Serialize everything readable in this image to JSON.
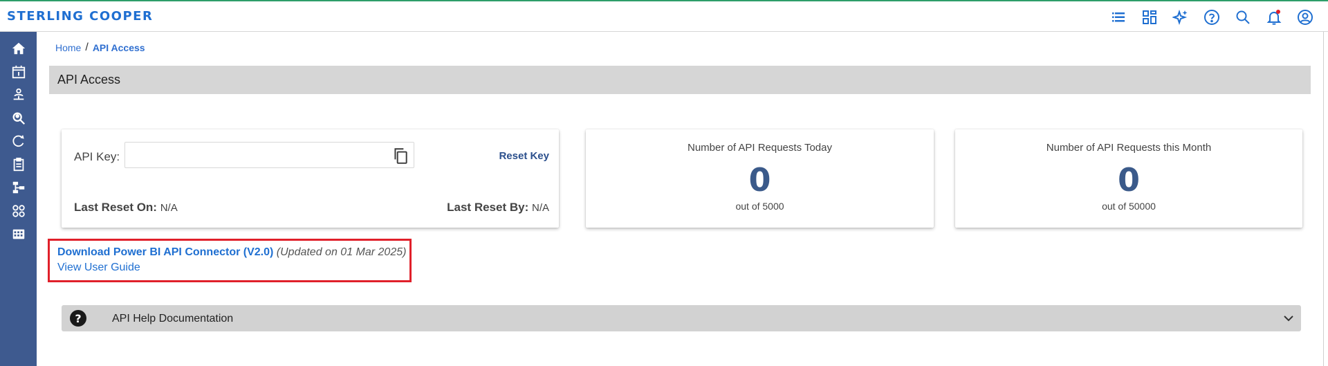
{
  "app": {
    "brand": "STERLING COOPER"
  },
  "topbar": {
    "icons": [
      "list-icon",
      "dashboard-icon",
      "sparkle-icon",
      "help-icon",
      "search-icon",
      "notification-bell-icon",
      "user-account-icon"
    ]
  },
  "sidebar": {
    "items": [
      "home-icon",
      "calendar-icon",
      "org-chart-icon",
      "search-person-icon",
      "cycle-icon",
      "clipboard-icon",
      "hierarchy-icon",
      "apps-icon",
      "reports-icon"
    ]
  },
  "breadcrumb": {
    "home": "Home",
    "separator": "/",
    "current": "API Access"
  },
  "page": {
    "title": "API Access"
  },
  "api_key_card": {
    "key_label": "API Key:",
    "key_value": "",
    "reset_label": "Reset Key",
    "last_reset_on_label": "Last Reset On:",
    "last_reset_on_value": "N/A",
    "last_reset_by_label": "Last Reset By:",
    "last_reset_by_value": "N/A"
  },
  "stats": {
    "today": {
      "label": "Number of API Requests Today",
      "value": "0",
      "sub": "out of 5000"
    },
    "month": {
      "label": "Number of API Requests this Month",
      "value": "0",
      "sub": "out of 50000"
    }
  },
  "download": {
    "link_label": "Download Power BI API Connector (V2.0)",
    "note": "(Updated on 01 Mar 2025)",
    "guide_label": "View User Guide"
  },
  "help": {
    "label": "API Help Documentation"
  },
  "colors": {
    "brand": "#1f6fd1",
    "sidebar": "#3e5a8f",
    "highlight": "#e0202a",
    "stat_value": "#3b5a8a"
  }
}
